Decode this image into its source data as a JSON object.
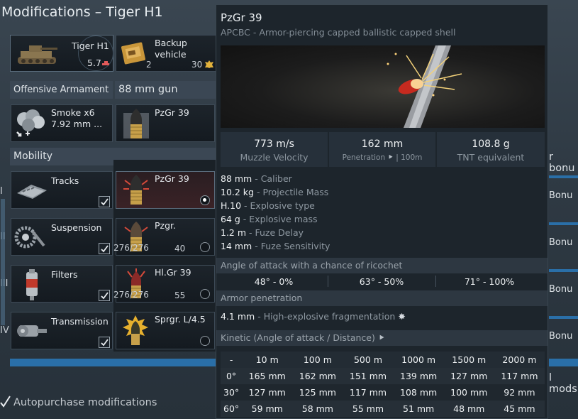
{
  "window": {
    "title": "Modifications – Tiger H1"
  },
  "vehicle": {
    "name": "Tiger H1",
    "br": "5.7"
  },
  "backup": {
    "label_line1": "Backup",
    "label_line2": "vehicle",
    "count": "2",
    "cost": "30"
  },
  "sections": {
    "offensive": "Offensive Armament",
    "weapon": "88 mm gun",
    "mobility": "Mobility"
  },
  "smoke": {
    "line1": "Smoke x6",
    "line2": "7.92 mm ..."
  },
  "shell_top": {
    "name": "PzGr 39"
  },
  "shells": [
    {
      "name": "PzGr 39",
      "selected": true
    },
    {
      "name": "Pzgr.",
      "count": "276/276",
      "ammo": "40"
    },
    {
      "name": "Hl.Gr 39",
      "count": "276/276",
      "ammo": "55"
    },
    {
      "name": "Sprgr. L/4.5"
    }
  ],
  "mobility_items": [
    {
      "label": "Tracks",
      "tier": "I"
    },
    {
      "label": "Suspension",
      "tier": "II"
    },
    {
      "label": "Filters",
      "tier": "III"
    },
    {
      "label": "Transmission",
      "tier": "IV"
    }
  ],
  "right_side": {
    "header": "r bonu",
    "bonus": "Bonu",
    "mods": "l mods"
  },
  "footer": {
    "autopurchase": "Autopurchase modifications"
  },
  "tooltip": {
    "name": "PzGr 39",
    "desc": "APCBC - Armor-piercing capped ballistic capped shell",
    "stats": [
      {
        "value": "773 m/s",
        "label": "Muzzle Velocity"
      },
      {
        "value": "162 mm",
        "label": "Penetration",
        "extra": "| 100m"
      },
      {
        "value": "108.8 g",
        "label": "TNT equivalent"
      }
    ],
    "props": [
      {
        "v": "88 mm",
        "k": "Caliber"
      },
      {
        "v": "10.2 kg",
        "k": "Projectile Mass"
      },
      {
        "v": "H.10",
        "k": "Explosive type"
      },
      {
        "v": "64 g",
        "k": "Explosive mass"
      },
      {
        "v": "1.2 m",
        "k": "Fuze Delay"
      },
      {
        "v": "14 mm",
        "k": "Fuze Sensitivity"
      }
    ],
    "ricochet_title": "Angle of attack with a chance of ricochet",
    "ricochet": [
      "48° - 0%",
      "63° - 50%",
      "71° - 100%"
    ],
    "armor_pen_title": "Armor penetration",
    "he_frag": {
      "v": "4.1 mm",
      "k": "High-explosive fragmentation"
    },
    "kinetic_title": "Kinetic (Angle of attack / Distance)",
    "table": {
      "header": [
        "-",
        "10 m",
        "100 m",
        "500 m",
        "1000 m",
        "1500 m",
        "2000 m"
      ],
      "rows": [
        [
          "0°",
          "165 mm",
          "162 mm",
          "151 mm",
          "139 mm",
          "127 mm",
          "117 mm"
        ],
        [
          "30°",
          "127 mm",
          "125 mm",
          "117 mm",
          "108 mm",
          "100 mm",
          "92 mm"
        ],
        [
          "60°",
          "59 mm",
          "58 mm",
          "55 mm",
          "51 mm",
          "48 mm",
          "45 mm"
        ]
      ]
    }
  }
}
